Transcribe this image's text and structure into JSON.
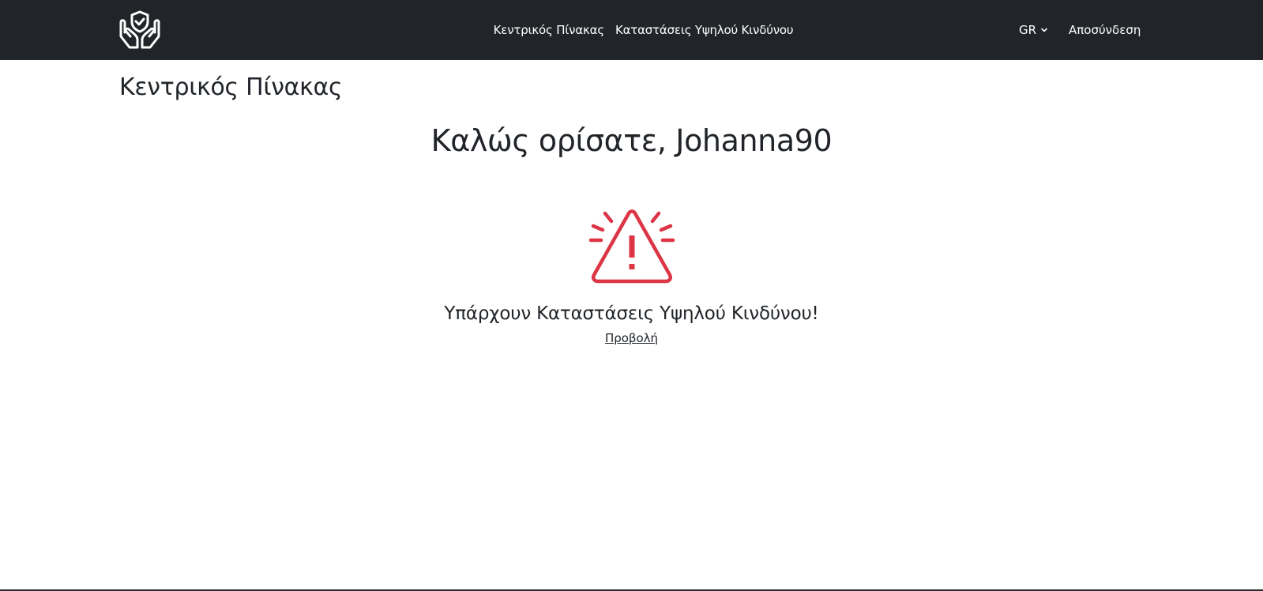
{
  "navbar": {
    "brand_icon": "hands-shield-check-icon",
    "links": [
      {
        "label": "Κεντρικός Πίνακας"
      },
      {
        "label": "Καταστάσεις Υψηλού Κινδύνου"
      }
    ],
    "language": "GR",
    "logout_label": "Αποσύνδεση"
  },
  "main": {
    "page_title": "Κεντρικός Πίνακας",
    "welcome": "Καλώς ορίσατε, Johanna90",
    "alert_icon": "warning-triangle-alarm-icon",
    "alert_text": "Υπάρχουν Καταστάσεις Υψηλού Κινδύνου!",
    "view_link": "Προβολή"
  },
  "colors": {
    "navbar_bg": "#212529",
    "alert_red": "#dc3545",
    "text": "#212529"
  }
}
